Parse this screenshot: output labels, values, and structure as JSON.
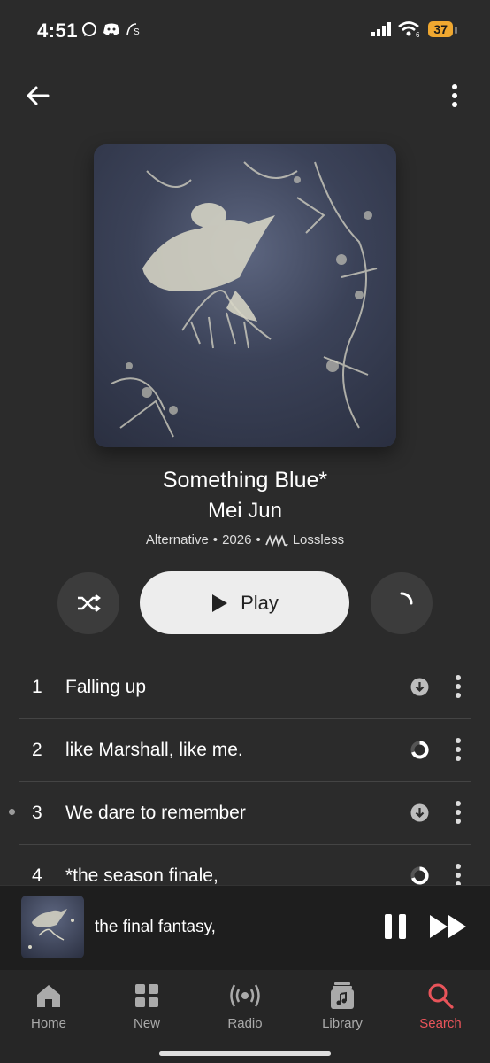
{
  "status_bar": {
    "time": "4:51",
    "battery": "37"
  },
  "album": {
    "title": "Something Blue*",
    "artist": "Mei Jun",
    "genre": "Alternative",
    "year": "2026",
    "quality": "Lossless",
    "separator": "•"
  },
  "actions": {
    "play_label": "Play"
  },
  "tracks": [
    {
      "number": "1",
      "title": "Falling up",
      "status": "download-icon"
    },
    {
      "number": "2",
      "title": "like Marshall, like me.",
      "status": "downloading-progress-icon"
    },
    {
      "number": "3",
      "title": "We dare to remember",
      "status": "download-icon",
      "playing": true
    },
    {
      "number": "4",
      "title": "*the season finale,",
      "status": "downloading-progress-icon"
    }
  ],
  "now_playing": {
    "title": "the final fantasy,"
  },
  "tabs": [
    {
      "label": "Home",
      "icon": "home-icon"
    },
    {
      "label": "New",
      "icon": "grid-icon"
    },
    {
      "label": "Radio",
      "icon": "radio-icon"
    },
    {
      "label": "Library",
      "icon": "library-icon"
    },
    {
      "label": "Search",
      "icon": "search-icon",
      "active": true
    }
  ],
  "colors": {
    "accent": "#e8545a",
    "background": "#2b2b2b",
    "battery": "#f0a830"
  }
}
